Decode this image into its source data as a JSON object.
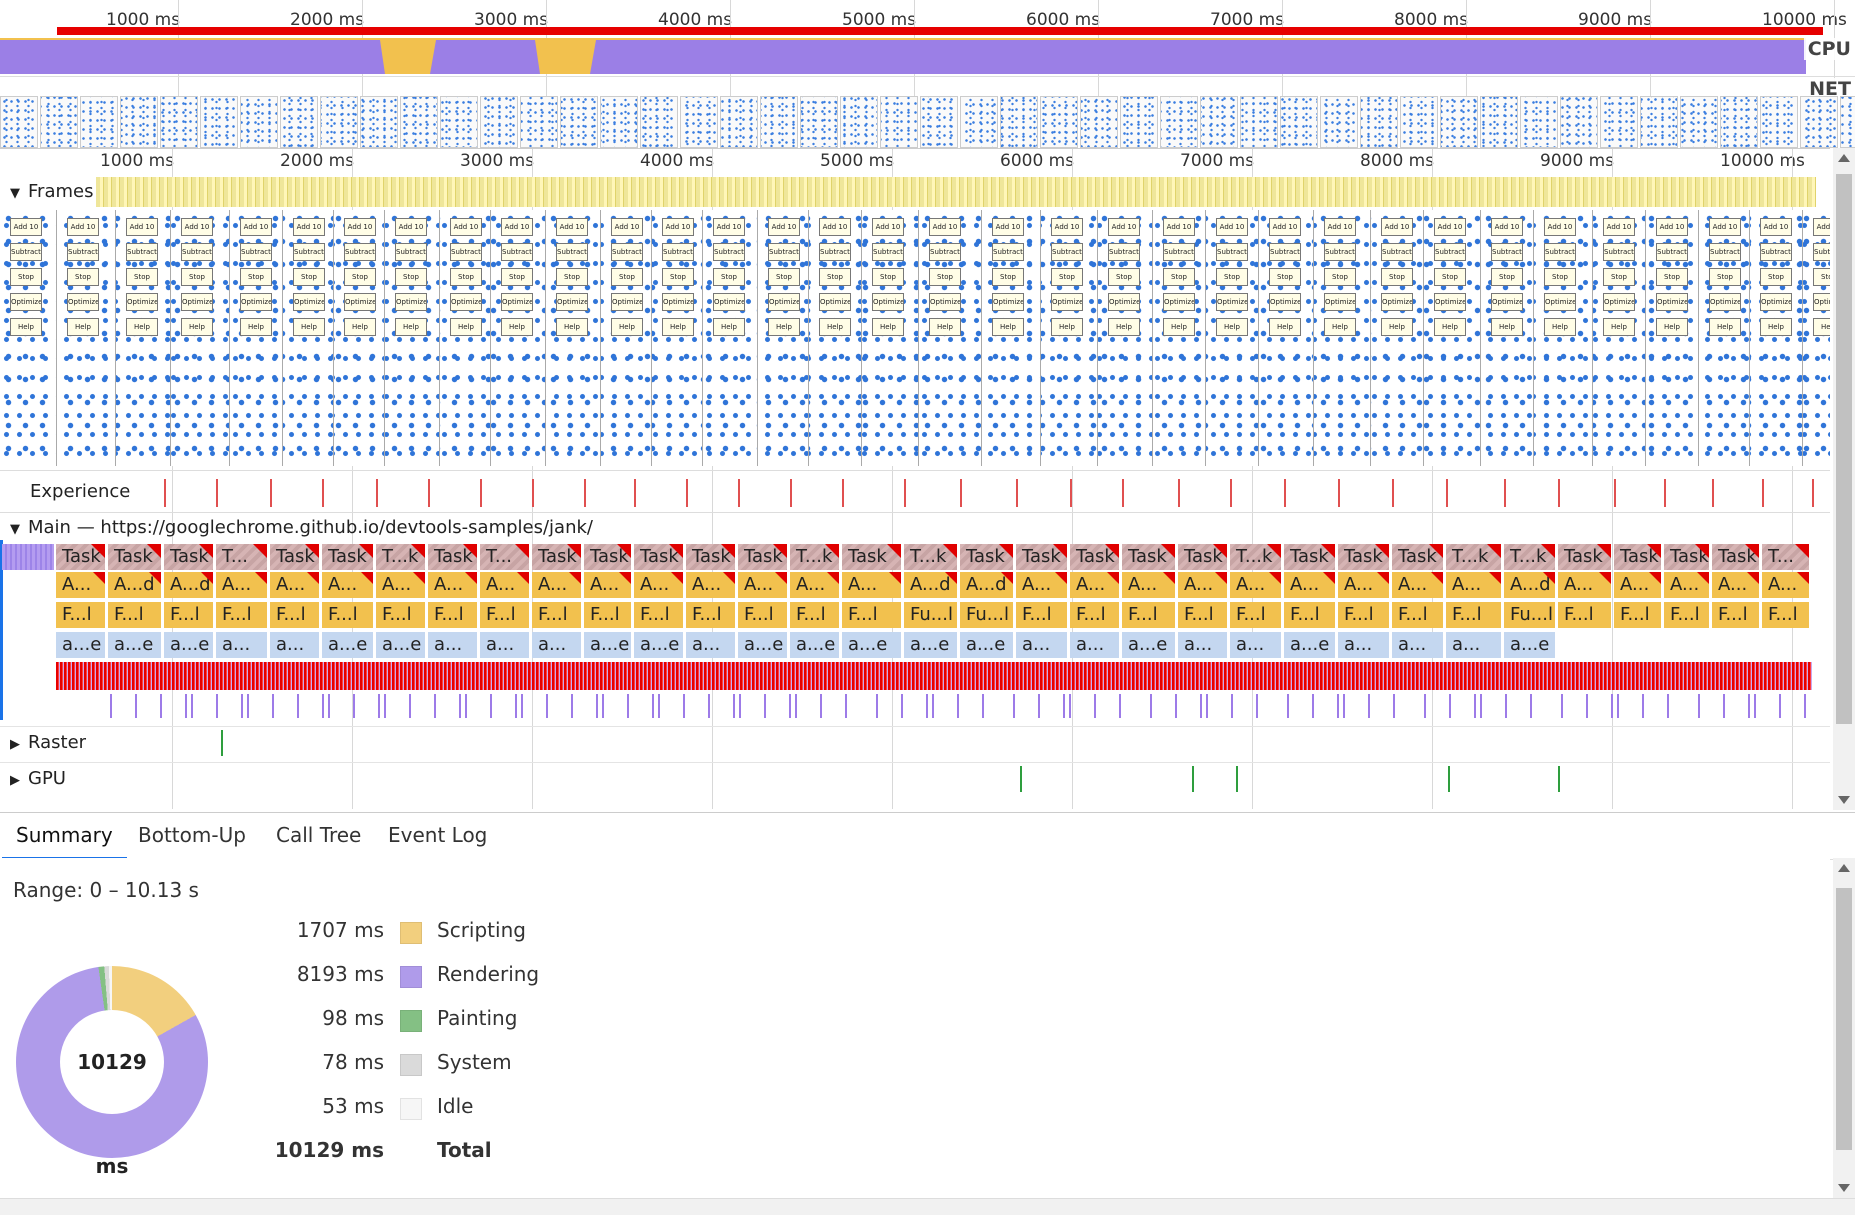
{
  "overview": {
    "ticks": [
      "1000 ms",
      "2000 ms",
      "3000 ms",
      "4000 ms",
      "5000 ms",
      "6000 ms",
      "7000 ms",
      "8000 ms",
      "9000 ms",
      "10000 ms"
    ],
    "cpu_label": "CPU",
    "net_label": "NET"
  },
  "ruler": {
    "ticks": [
      "1000 ms",
      "2000 ms",
      "3000 ms",
      "4000 ms",
      "5000 ms",
      "6000 ms",
      "7000 ms",
      "8000 ms",
      "9000 ms",
      "10000 ms"
    ]
  },
  "tracks": {
    "frames_label": "Frames",
    "experience_label": "Experience",
    "main_label": "Main — https://googlechrome.github.io/devtools-samples/jank/",
    "raster_label": "Raster",
    "gpu_label": "GPU"
  },
  "app_buttons": [
    "Add 10",
    "Subtract 10",
    "Stop",
    "Optimize",
    "Help"
  ],
  "main_rows": {
    "task_labels": [
      "Task",
      "Task",
      "Task",
      "T...",
      "Task",
      "Task",
      "T...k",
      "Task",
      "T...",
      "Task",
      "Task",
      "Task",
      "Task",
      "Task",
      "T...k",
      "Task",
      "T...k",
      "Task",
      "Task",
      "Task",
      "Task",
      "Task",
      "T...k",
      "Task",
      "Task",
      "Task",
      "T...k",
      "T...k",
      "Task",
      "Task",
      "Task",
      "Task",
      "T...",
      "Task"
    ],
    "anim_labels": [
      "A...",
      "A...d",
      "A...d",
      "A...",
      "A...",
      "A...",
      "A...",
      "A...",
      "A...",
      "A...",
      "A...",
      "A...",
      "A...",
      "A...",
      "A...",
      "A...",
      "A...d",
      "A...d",
      "A...",
      "A...",
      "A...",
      "A...",
      "A...",
      "A...",
      "A...",
      "A...",
      "A...",
      "A...d",
      "A...",
      "A...",
      "A...",
      "A...",
      "A..."
    ],
    "func_labels": [
      "F...l",
      "F...l",
      "F...l",
      "F...l",
      "F...l",
      "F...l",
      "F...l",
      "F...l",
      "F...l",
      "F...l",
      "F...l",
      "F...l",
      "F...l",
      "F...l",
      "F...l",
      "F...l",
      "Fu...l",
      "Fu...l",
      "F...l",
      "F...l",
      "F...l",
      "F...l",
      "F...l",
      "F...l",
      "F...l",
      "F...l",
      "F...l",
      "Fu...l",
      "F...l",
      "F...l",
      "F...l",
      "F...l",
      "F...l"
    ],
    "anon_labels": [
      "a...e",
      "a...e",
      "a...e",
      "a...",
      "a...",
      "a...e",
      "a...e",
      "a...",
      "a...",
      "a...",
      "a...e",
      "a...e",
      "a...",
      "a...e",
      "a...e",
      "a...e",
      "a...e",
      "a...e",
      "a...",
      "a...",
      "a...e",
      "a...",
      "a...",
      "a...e",
      "a...",
      "a...",
      "a...",
      "a...e"
    ]
  },
  "bottom_tabs": {
    "summary": "Summary",
    "bottom_up": "Bottom-Up",
    "call_tree": "Call Tree",
    "event_log": "Event Log"
  },
  "summary": {
    "range": "Range: 0 – 10.13 s",
    "total_center": "10129 ms",
    "items": [
      {
        "value": "1707 ms",
        "label": "Scripting",
        "color": "#f2cf7e"
      },
      {
        "value": "8193 ms",
        "label": "Rendering",
        "color": "#af9bea"
      },
      {
        "value": "98 ms",
        "label": "Painting",
        "color": "#84c084"
      },
      {
        "value": "78 ms",
        "label": "System",
        "color": "#dadada"
      },
      {
        "value": "53 ms",
        "label": "Idle",
        "color": "#f6f6f6"
      }
    ],
    "total": {
      "value": "10129 ms",
      "label": "Total"
    }
  }
}
